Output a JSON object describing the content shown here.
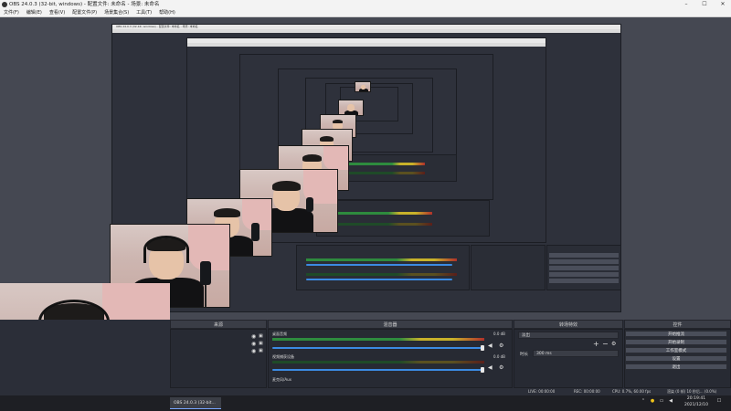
{
  "window": {
    "title": "OBS 24.0.3 (32-bit, windows) - 配置文件: 未命名 - 场景: 未命名",
    "minimize": "–",
    "maximize": "☐",
    "close": "✕"
  },
  "menu": [
    "文件(F)",
    "编辑(E)",
    "查看(V)",
    "配置文件(P)",
    "场景集合(S)",
    "工具(T)",
    "帮助(H)"
  ],
  "inner_window_title": "OBS 24.0.3 (32-bit, windows) - 配置文件: 未命名 - 场景: 未命名",
  "docks": {
    "sources": {
      "label": "来源"
    },
    "mixer": {
      "label": "混音器",
      "channels": [
        {
          "name": "桌面音频",
          "level": "0.0 dB"
        },
        {
          "name": "视频捕获设备",
          "level": "0.0 dB"
        },
        {
          "name": "麦克风/Aux",
          "level": ""
        }
      ]
    },
    "transitions": {
      "label": "转场特效",
      "selected": "淡出",
      "duration_label": "时长",
      "duration_value": "300 ms"
    },
    "controls": {
      "label": "控件",
      "buttons": [
        "开始推流",
        "开始录制",
        "工作室模式",
        "设置",
        "退出"
      ]
    }
  },
  "status": {
    "live": "LIVE: 00:00:00",
    "rec": "REC: 00:00:00",
    "cpu": "CPU: 0.7%, 60.00 fps",
    "extra": "渲染 (0 帧) 10 秒后... (0.0%)"
  },
  "taskbar": {
    "task_label": "OBS 24.0.3 (32-bit...",
    "time": "20:19:41",
    "date": "2021/12/10"
  }
}
